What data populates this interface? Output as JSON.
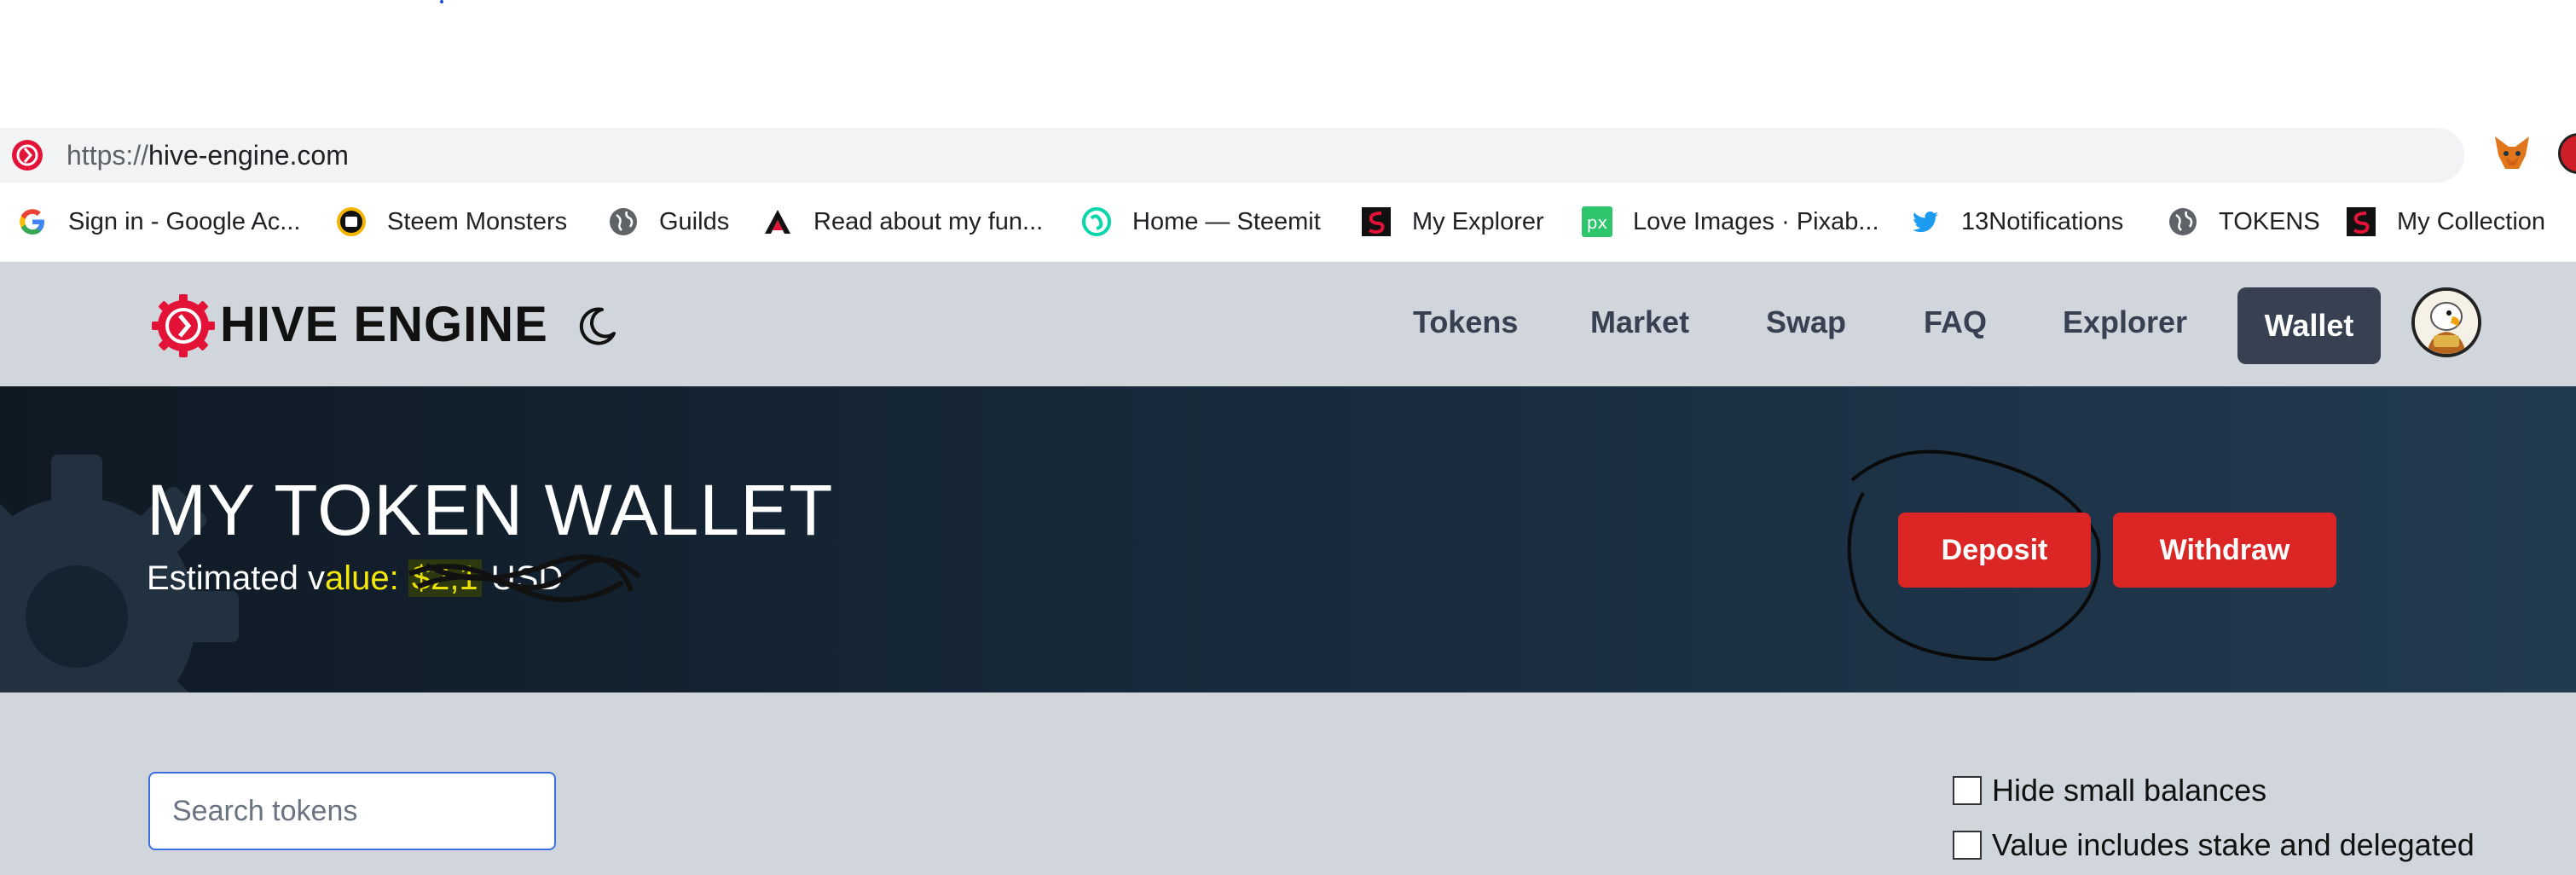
{
  "browser": {
    "url_protocol": "https://",
    "url_host": "hive-engine.com",
    "bookmarks": [
      {
        "label": "Sign in - Google Ac...",
        "icon": "google-icon"
      },
      {
        "label": "Steem Monsters",
        "icon": "steem-monsters-icon"
      },
      {
        "label": "Guilds",
        "icon": "globe-icon"
      },
      {
        "label": "Read about my fun...",
        "icon": "triangle-logo-icon"
      },
      {
        "label": "Home — Steemit",
        "icon": "steemit-icon"
      },
      {
        "label": "My Explorer",
        "icon": "steem-red-icon"
      },
      {
        "label": "Love Images · Pixab...",
        "icon": "pixabay-icon"
      },
      {
        "label": "13Notifications",
        "icon": "twitter-icon"
      },
      {
        "label": "TOKENS",
        "icon": "globe-icon"
      },
      {
        "label": "My Collection",
        "icon": "steem-red-icon"
      }
    ]
  },
  "header": {
    "brand": "HIVE ENGINE",
    "nav": {
      "tokens": "Tokens",
      "market": "Market",
      "swap": "Swap",
      "faq": "FAQ",
      "explorer": "Explorer",
      "wallet": "Wallet"
    }
  },
  "hero": {
    "title": "MY TOKEN WALLET",
    "estimated_prefix": "Estimated v",
    "estimated_label_highlight": "alue: ",
    "estimated_value": "$2,1",
    "currency": " USD",
    "deposit_label": "Deposit",
    "withdraw_label": "Withdraw"
  },
  "content": {
    "search_placeholder": "Search tokens",
    "hide_small_label": "Hide small balances",
    "value_includes_label": "Value includes stake and delegated"
  },
  "colors": {
    "accent_red": "#dc2626",
    "nav_bg": "#d1d5dc",
    "wallet_active": "#374151",
    "hero_dark": "#0f1923"
  }
}
